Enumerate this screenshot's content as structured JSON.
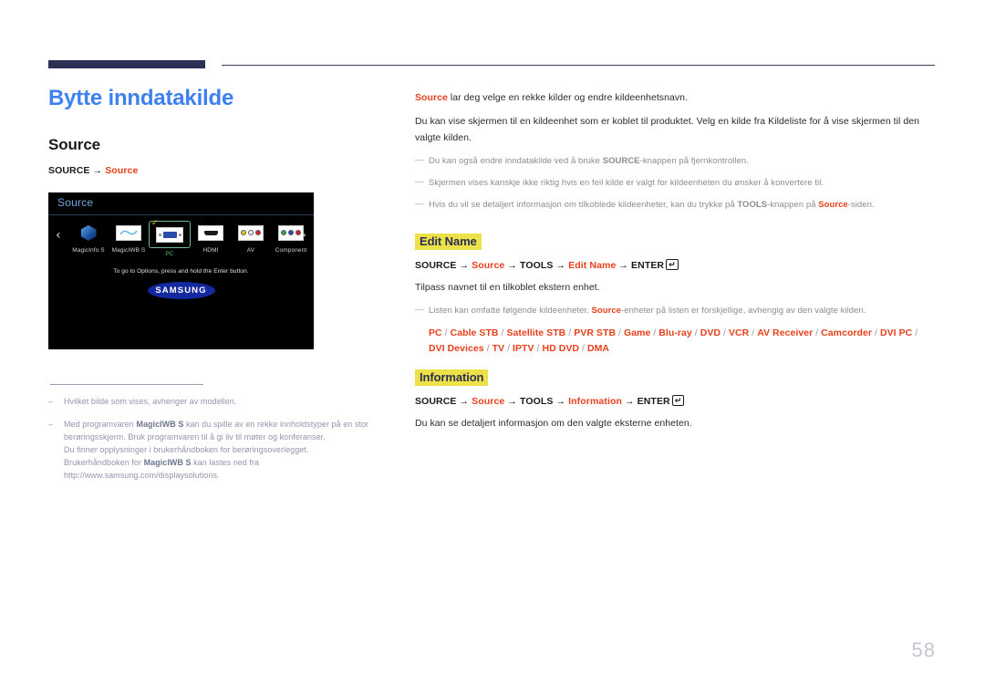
{
  "header": {
    "rule_color_thick": "#2b3054",
    "rule_color_thin": "#3a3f5e"
  },
  "left": {
    "chapter_title": "Bytte inndatakilde",
    "section_title": "Source",
    "menu_path": {
      "root": "SOURCE",
      "arrow": "→",
      "target": "Source"
    },
    "tv": {
      "title": "Source",
      "nav_left": "‹",
      "nav_right": "›",
      "check_mark": "✓",
      "sources": [
        {
          "label": "MagicInfo S",
          "icon": "magicinfo-icon",
          "selected": false
        },
        {
          "label": "MagicIWB S",
          "icon": "magiciwb-icon",
          "selected": false
        },
        {
          "label": "PC",
          "icon": "pc-connector-icon",
          "selected": true
        },
        {
          "label": "HDMI",
          "icon": "hdmi-port-icon",
          "selected": false
        },
        {
          "label": "AV",
          "icon": "av-rca-icon",
          "selected": false
        },
        {
          "label": "Component",
          "icon": "component-rca-icon",
          "selected": false
        }
      ],
      "hint": "To go to Options, press and hold the Enter button.",
      "brand": "SAMSUNG"
    },
    "footnotes": [
      {
        "dash": "–",
        "parts": [
          {
            "t": "Hvilket bilde som vises, avhenger av modellen.",
            "b": false
          }
        ]
      },
      {
        "dash": "–",
        "parts": [
          {
            "t": "Med programvaren ",
            "b": false
          },
          {
            "t": "MagicIWB S",
            "b": true
          },
          {
            "t": " kan du spille av en rekke innholdstyper på en stor berøringsskjerm. Bruk programvaren til å gi liv til møter og konferanser.",
            "b": false
          },
          {
            "t": "\nDu finner opplysninger i brukerhåndboken for berøringsoverlegget.\nBrukerhåndboken for ",
            "b": false
          },
          {
            "t": "MagicIWB S",
            "b": true
          },
          {
            "t": " kan lastes ned fra http://www.samsung.com/displaysolutions.",
            "b": false
          }
        ]
      }
    ]
  },
  "right": {
    "intro": [
      {
        "t": "Source",
        "style": "red"
      },
      {
        "t": " lar deg velge en rekke kilder og endre kildeenhetsnavn.",
        "style": "normal"
      }
    ],
    "paragraph2": "Du kan vise skjermen til en kildeenhet som er koblet til produktet. Velg en kilde fra Kildeliste for å vise skjermen til den valgte kilden.",
    "notes": [
      [
        {
          "t": "Du kan også endre inndatakilde ved å bruke ",
          "style": "normal"
        },
        {
          "t": "SOURCE",
          "style": "bold"
        },
        {
          "t": "-knappen på fjernkontrollen.",
          "style": "normal"
        }
      ],
      [
        {
          "t": "Skjermen vises kanskje ikke riktig hvis en feil kilde er valgt for kildeenheten du ønsker å konvertere til.",
          "style": "normal"
        }
      ],
      [
        {
          "t": "Hvis du vil se detaljert informasjon om tilkoblede kildeenheter, kan du trykke på ",
          "style": "normal"
        },
        {
          "t": "TOOLS",
          "style": "bold"
        },
        {
          "t": "-knappen på ",
          "style": "normal"
        },
        {
          "t": "Source",
          "style": "red"
        },
        {
          "t": "-siden.",
          "style": "normal"
        }
      ]
    ],
    "edit_name": {
      "heading": "Edit Name",
      "path": [
        {
          "t": "SOURCE",
          "style": "bold"
        },
        {
          "t": " → ",
          "style": "arrow"
        },
        {
          "t": "Source",
          "style": "red"
        },
        {
          "t": " → ",
          "style": "arrow"
        },
        {
          "t": "TOOLS",
          "style": "bold"
        },
        {
          "t": " → ",
          "style": "arrow"
        },
        {
          "t": "Edit Name",
          "style": "red"
        },
        {
          "t": " → ",
          "style": "arrow"
        },
        {
          "t": "ENTER",
          "style": "bold"
        }
      ],
      "enter_key_glyph": "↵",
      "body": "Tilpass navnet til en tilkoblet ekstern enhet.",
      "note": [
        {
          "t": "Listen kan omfatte følgende kildeenheter. ",
          "style": "normal"
        },
        {
          "t": "Source",
          "style": "red"
        },
        {
          "t": "-enheter på listen er forskjellige, avhengig av den valgte kilden.",
          "style": "normal"
        }
      ],
      "device_list": [
        "PC",
        "Cable STB",
        "Satellite STB",
        "PVR STB",
        "Game",
        "Blu-ray",
        "DVD",
        "VCR",
        "AV Receiver",
        "Camcorder",
        "DVI PC",
        "DVI Devices",
        "TV",
        "IPTV",
        "HD DVD",
        "DMA"
      ],
      "device_separator": "/"
    },
    "information": {
      "heading": "Information",
      "path": [
        {
          "t": "SOURCE",
          "style": "bold"
        },
        {
          "t": " → ",
          "style": "arrow"
        },
        {
          "t": "Source",
          "style": "red"
        },
        {
          "t": " → ",
          "style": "arrow"
        },
        {
          "t": "TOOLS",
          "style": "bold"
        },
        {
          "t": " → ",
          "style": "arrow"
        },
        {
          "t": "Information",
          "style": "red"
        },
        {
          "t": " → ",
          "style": "arrow"
        },
        {
          "t": "ENTER",
          "style": "bold"
        }
      ],
      "enter_key_glyph": "↵",
      "body": "Du kan se detaljert informasjon om den valgte eksterne enheten."
    }
  },
  "page_number": "58",
  "colors": {
    "accent_blue": "#3d80ef",
    "accent_red": "#e8401c",
    "highlight_yellow": "#ede14a",
    "navy": "#2b3054",
    "muted": "#9096ad"
  }
}
